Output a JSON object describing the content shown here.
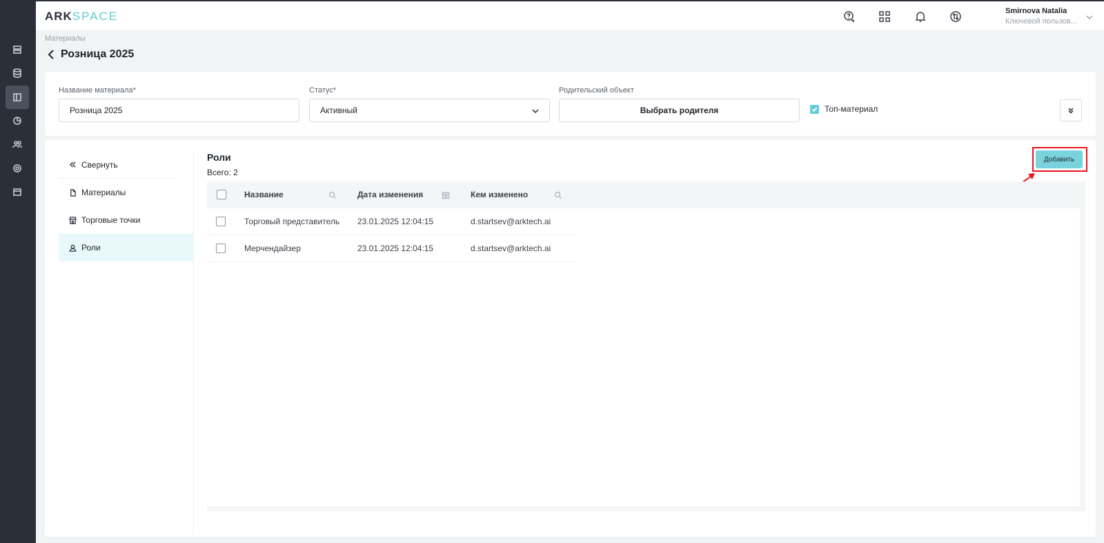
{
  "app": {
    "logo_left": "ARK",
    "logo_right": "SPACE"
  },
  "user": {
    "name": "Smirnova Natalia",
    "role": "Ключевой пользов..."
  },
  "breadcrumb": "Материалы",
  "page_title": "Розница 2025",
  "form": {
    "name_label": "Название материала*",
    "name_value": "Розница 2025",
    "status_label": "Статус*",
    "status_value": "Активный",
    "parent_label": "Родительский объект",
    "parent_button": "Выбрать родителя",
    "top_material_label": "Топ-материал",
    "top_material_checked": true
  },
  "side_nav": {
    "collapse_label": "Свернуть",
    "items": [
      {
        "label": "Материалы",
        "icon": "file-icon"
      },
      {
        "label": "Торговые точки",
        "icon": "store-icon"
      },
      {
        "label": "Роли",
        "icon": "user-icon",
        "active": true
      }
    ]
  },
  "section": {
    "title": "Роли",
    "total": "Всего: 2",
    "add_button": "Добавить"
  },
  "table": {
    "columns": [
      "Название",
      "Дата изменения",
      "Кем изменено"
    ],
    "rows": [
      {
        "name": "Торговый представитель",
        "date": "23.01.2025 12:04:15",
        "by": "d.startsev@arktech.ai"
      },
      {
        "name": "Мерчендайзер",
        "date": "23.01.2025 12:04:15",
        "by": "d.startsev@arktech.ai"
      }
    ]
  },
  "colors": {
    "accent": "#62ccd8",
    "rail": "#2b2f38",
    "highlight": "#e8141b"
  }
}
